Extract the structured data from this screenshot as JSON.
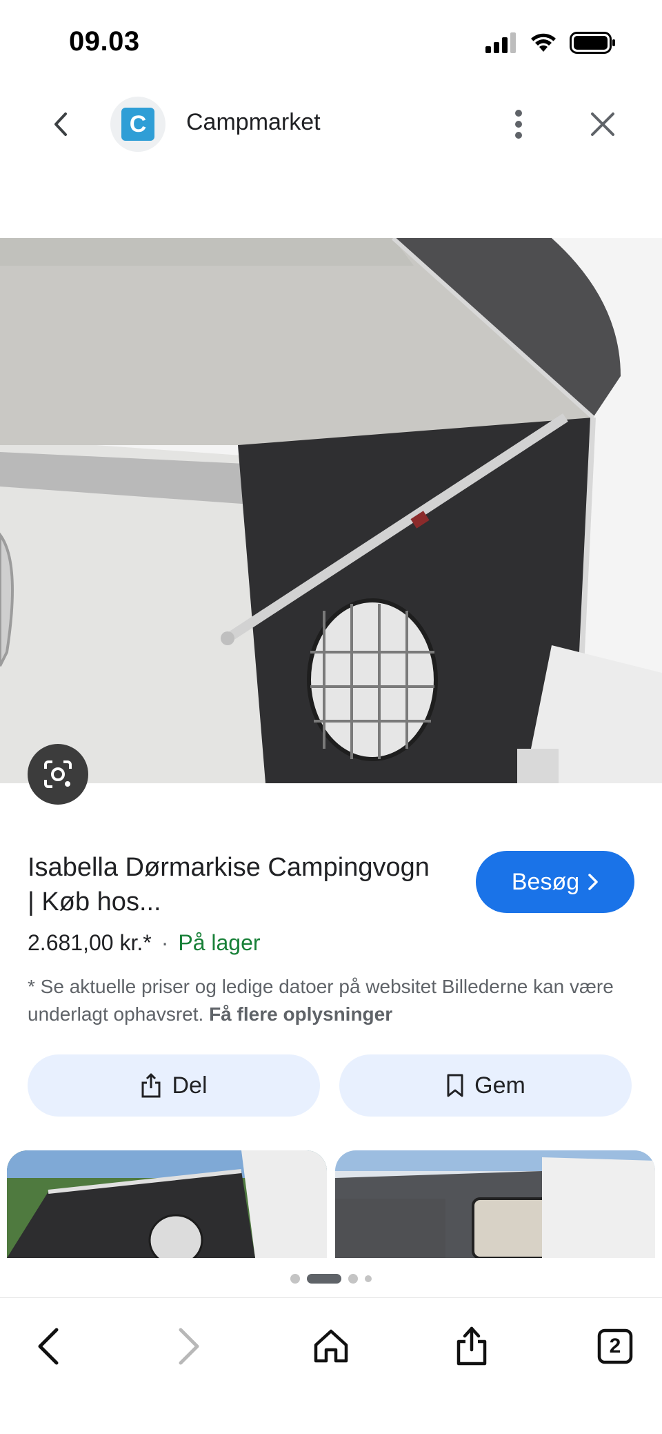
{
  "status_bar": {
    "time": "09.03"
  },
  "header": {
    "site_name": "Campmarket",
    "site_logo_letter": "C"
  },
  "product": {
    "title": "Isabella Dørmarkise Campingvogn | Køb hos...",
    "price": "2.681,00 kr.*",
    "separator": "·",
    "stock": "På lager",
    "disclaimer_text": "* Se aktuelle priser og ledige datoer på websitet Billederne kan være underlagt ophavsret.",
    "more_info_link": "Få flere oplysninger",
    "visit_label": "Besøg"
  },
  "actions": {
    "share_label": "Del",
    "save_label": "Gem"
  },
  "pager": {
    "count": 4,
    "active_index": 1
  },
  "bottom_nav": {
    "tab_count": "2"
  },
  "colors": {
    "accent": "#1a73e8",
    "stock_green": "#188038",
    "action_bg": "#e8f0fe"
  }
}
